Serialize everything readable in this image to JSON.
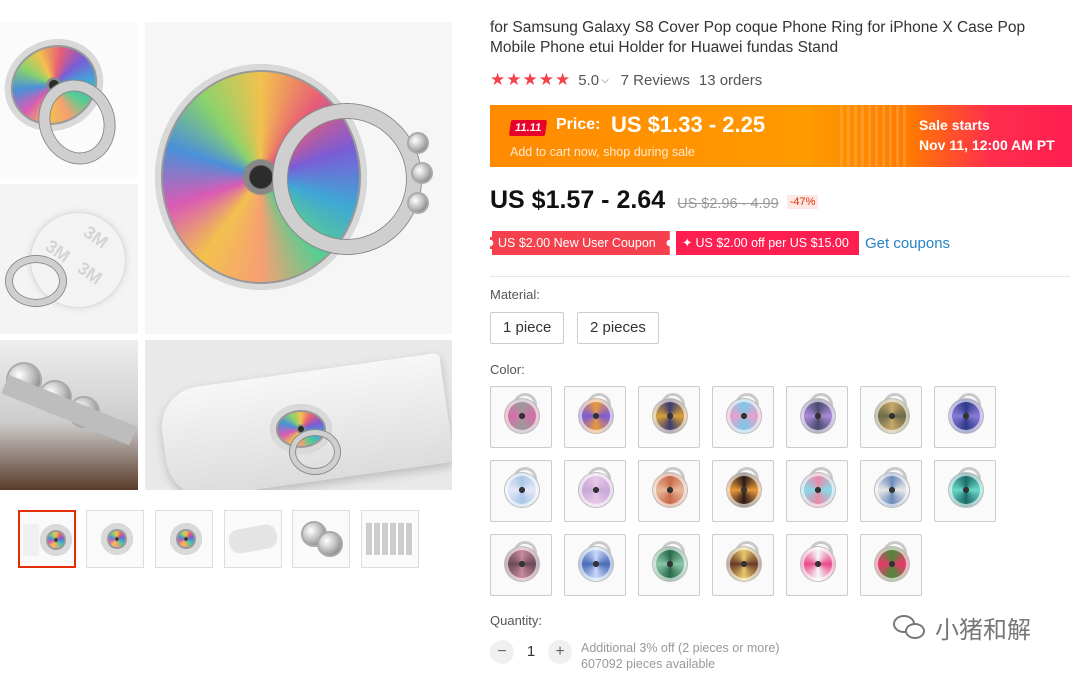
{
  "product": {
    "title": "for Samsung Galaxy S8 Cover Pop coque Phone Ring for iPhone X Case Pop Mobile Phone etui Holder for Huawei fundas Stand",
    "rating": "5.0",
    "reviews": "7 Reviews",
    "orders": "13 orders"
  },
  "promo": {
    "badge": "11.11",
    "price_label": "Price:",
    "price_value": "US $1.33 - 2.25",
    "subtitle": "Add to cart now, shop during sale",
    "sale_starts_label": "Sale starts",
    "sale_starts_date": "Nov 11, 12:00 AM PT"
  },
  "pricing": {
    "current": "US $1.57 - 2.64",
    "original": "US $2.96 - 4.99",
    "discount": "-47%"
  },
  "coupons": {
    "new_user": "US $2.00 New User Coupon",
    "off_per": "US $2.00 off per US $15.00",
    "get_link": "Get coupons"
  },
  "material": {
    "label": "Material:",
    "options": [
      "1 piece",
      "2 pieces"
    ]
  },
  "color": {
    "label": "Color:",
    "swatches": [
      [
        "#9a9a9a",
        "#d86fa8"
      ],
      [
        "#e89a3c",
        "#7a5cd6"
      ],
      [
        "#3b3b6e",
        "#d8a23a"
      ],
      [
        "#7fc8e8",
        "#e8a0c8"
      ],
      [
        "#4b4b6b",
        "#a88ad8"
      ],
      [
        "#c8a868",
        "#6a6a4a"
      ],
      [
        "#2e3a8a",
        "#8a7ad8"
      ],
      [
        "#a8c8e8",
        "#e8e8f8"
      ],
      [
        "#e8c8e8",
        "#c8a8d8"
      ],
      [
        "#c86a4a",
        "#e8b89a"
      ],
      [
        "#2a1a1a",
        "#e89a3a"
      ],
      [
        "#e88aa8",
        "#8ad8e8"
      ],
      [
        "#6a8ab8",
        "#e8e8e8"
      ],
      [
        "#1a6a6a",
        "#6ad8c8"
      ],
      [
        "#c88a9a",
        "#6a4a5a"
      ],
      [
        "#c8d8f8",
        "#4a6ab8"
      ],
      [
        "#2a6a4a",
        "#8ac8a8"
      ],
      [
        "#e8c86a",
        "#6a3a2a"
      ],
      [
        "#f8f8f8",
        "#e84a8a"
      ],
      [
        "#4a8a3a",
        "#e83a6a"
      ]
    ]
  },
  "quantity": {
    "label": "Quantity:",
    "value": "1",
    "note_line1": "Additional 3% off (2 pieces or more)",
    "note_line2": "607092 pieces available"
  },
  "watermark": "小猪和解",
  "colors": {
    "accent": "#e62e04",
    "stars": "#f5414d",
    "link": "#2783c4",
    "banner_orange": "#ff8a00",
    "banner_red": "#ff1e50"
  }
}
